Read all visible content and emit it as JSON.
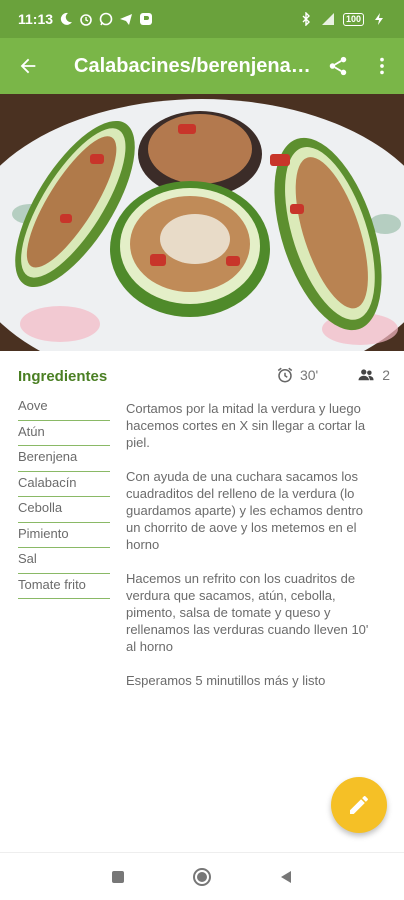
{
  "status_bar": {
    "time": "11:13",
    "battery": "100"
  },
  "app_bar": {
    "title": "Calabacines/berenjenas rellenas",
    "back_icon": "arrow-back-icon",
    "share_icon": "share-icon",
    "menu_icon": "more-vert-icon"
  },
  "hero": {
    "alt": "Stuffed zucchini and eggplant halves on a floral plate"
  },
  "ingredients_section": {
    "title": "Ingredientes",
    "time": "30'",
    "servings": "2",
    "items": [
      "Aove",
      "Atún",
      "Berenjena",
      "Calabacín",
      "Cebolla",
      "Pimiento",
      "Sal",
      "Tomate frito"
    ]
  },
  "instructions": [
    "Cortamos por la mitad la verdura y luego hacemos cortes en X sin llegar a cortar la piel.",
    "Con ayuda de una cuchara sacamos los cuadraditos del relleno de la verdura (lo guardamos aparte) y les echamos dentro un chorrito de aove y los metemos en el horno",
    "Hacemos un refrito con los cuadritos de verdura que sacamos, atún, cebolla, pimento, salsa de tomate y queso y rellenamos las verduras cuando lleven 10' al horno",
    "Esperamos 5 minutillos más y listo"
  ],
  "colors": {
    "status_bar": "#6aa23c",
    "app_bar": "#7ab648",
    "accent_text": "#4a7f23",
    "fab": "#f5c026"
  }
}
